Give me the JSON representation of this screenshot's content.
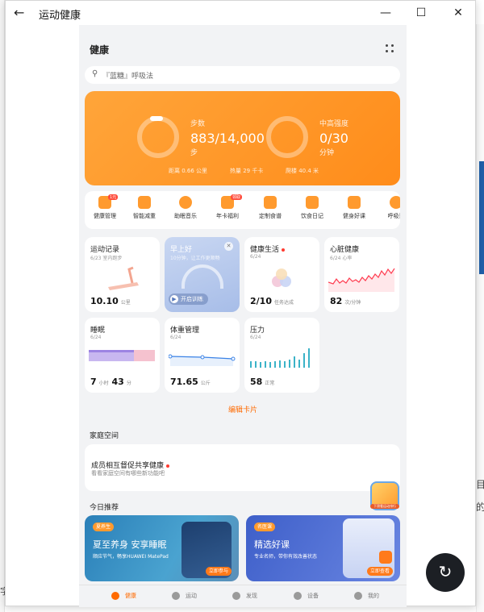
{
  "window": {
    "title": "运动健康",
    "back": "←",
    "min": "—",
    "max": "☐",
    "close": "✕"
  },
  "app": {
    "header_title": "健康",
    "search_placeholder": "『蓝糖』呼吸法",
    "activity": {
      "steps_label": "步数",
      "steps_value": "883/14,000",
      "steps_unit": "步",
      "intensity_label": "中高强度",
      "intensity_value": "0/30",
      "intensity_unit": "分钟",
      "distance": "距离 0.66 公里",
      "calories": "热量 29 千卡",
      "floors": "爬楼 40.4 米"
    },
    "shortcuts": [
      {
        "label": "健康管理",
        "badge": "1元"
      },
      {
        "label": "智能减重",
        "badge": ""
      },
      {
        "label": "助眠音乐",
        "badge": ""
      },
      {
        "label": "年卡福利",
        "badge": "领取"
      },
      {
        "label": "定制食谱",
        "badge": ""
      },
      {
        "label": "饮食日记",
        "badge": ""
      },
      {
        "label": "健身好课",
        "badge": ""
      },
      {
        "label": "呼吸训",
        "badge": ""
      }
    ],
    "cards": {
      "exercise": {
        "title": "运动记录",
        "date": "6/23 室内跑步",
        "value": "10.10",
        "unit": "公里"
      },
      "morning": {
        "title": "早上好",
        "sub": "10分钟，让工作更顺畅",
        "btn": "开启训练",
        "close": "✕"
      },
      "life": {
        "title": "健康生活",
        "date": "6/24",
        "value": "2/10",
        "unit": "任务达成"
      },
      "heart": {
        "title": "心脏健康",
        "date": "6/24 心率",
        "value": "82",
        "unit": "次/分钟"
      },
      "sleep": {
        "title": "睡眠",
        "date": "6/24",
        "value_h": "7",
        "unit_h": "小时",
        "value_m": "43",
        "unit_m": "分"
      },
      "weight": {
        "title": "体重管理",
        "date": "6/24",
        "value": "71.65",
        "unit": "公斤"
      },
      "stress": {
        "title": "压力",
        "date": "6/24",
        "value": "58",
        "unit": "正常"
      }
    },
    "edit_cards": "编辑卡片",
    "family": {
      "section": "家庭空间",
      "title": "成员相互督促共享健康",
      "sub": "看看家庭空间有哪些新功能吧"
    },
    "recommend": {
      "section": "今日推荐",
      "left": {
        "tag": "夏养生",
        "title": "夏至养身 安享睡眠",
        "sub": "顺应节气，畅享HUAWEI MatePad",
        "btn": "立即参与"
      },
      "right": {
        "tag": "名医课",
        "title": "精选好课",
        "sub": "专业名师，带你有效改善状态",
        "btn": "立即查看"
      }
    },
    "nav": [
      {
        "label": "健康",
        "active": true
      },
      {
        "label": "运动",
        "active": false
      },
      {
        "label": "发现",
        "active": false
      },
      {
        "label": "设备",
        "active": false
      },
      {
        "label": "我的",
        "active": false
      }
    ],
    "promo_badge": "下滑看运动排行"
  },
  "backdrop": {
    "right_text_1": "目",
    "right_text_2": "的",
    "left_text": "字"
  },
  "float_refresh": "↻"
}
